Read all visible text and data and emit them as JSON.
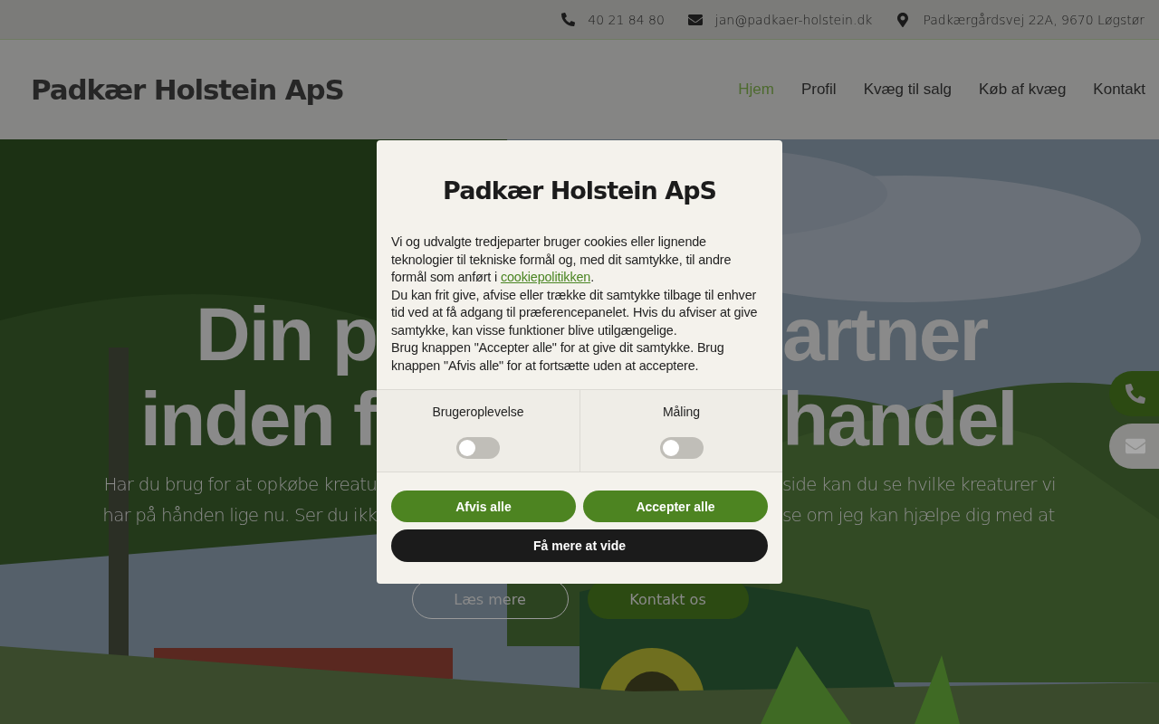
{
  "top_bar": {
    "phone": "40 21 84 80",
    "email": "jan@padkaer-holstein.dk",
    "address": "Padkærgårdsvej 22A, 9670 Løgstør"
  },
  "header": {
    "logo": "Padkær Holstein ApS",
    "nav": [
      {
        "label": "Hjem",
        "selected": true
      },
      {
        "label": "Profil",
        "selected": false
      },
      {
        "label": "Kvæg til salg",
        "selected": false
      },
      {
        "label": "Køb af kvæg",
        "selected": false
      },
      {
        "label": "Kontakt",
        "selected": false
      }
    ]
  },
  "hero": {
    "heading_lines": [
      {
        "left": "Din p",
        "right": "artner"
      },
      {
        "left": "inden f",
        "right": "handel"
      }
    ],
    "text_lines": [
      {
        "left": "Har du brug for at opkøbe kreatu",
        "right": "side kan du se hvilke kreaturer vi"
      },
      {
        "left": "har på hånden lige nu. Ser du ikk",
        "right": "se om jeg kan hjælpe dig med at"
      }
    ],
    "buttons": [
      {
        "label": "Læs mere",
        "kind": "outline"
      },
      {
        "label": "Kontakt os",
        "kind": "filled"
      }
    ]
  },
  "side_buttons": [
    {
      "kind": "phone",
      "color": "#2c4a12"
    },
    {
      "kind": "mail",
      "color": "#8a8a88"
    }
  ],
  "cookie_dialog": {
    "logo": "Padkær Holstein ApS",
    "paragraphs": [
      {
        "before": "Vi og udvalgte tredjeparter bruger cookies eller lignende teknologier til tekniske formål og, med dit samtykke, til andre formål som anført i ",
        "link": "cookiepolitikken",
        "after": "."
      },
      {
        "before": "Du kan frit give, afvise eller trække dit samtykke tilbage til enhver tid ved at få adgang til præferencepanelet. Hvis du afviser at give samtykke, kan visse funktioner blive utilgængelige."
      },
      {
        "before": "Brug knappen \"Accepter alle\" for at give dit samtykke. Brug knappen \"Afvis alle\" for at fortsætte uden at acceptere."
      }
    ],
    "categories": [
      {
        "label": "Brugeroplevelse",
        "on": false
      },
      {
        "label": "Måling",
        "on": false
      }
    ],
    "buttons": [
      {
        "label": "Afvis alle",
        "kind": "primary"
      },
      {
        "label": "Accepter alle",
        "kind": "primary"
      },
      {
        "label": "Få mere at vide",
        "kind": "dark"
      }
    ]
  }
}
